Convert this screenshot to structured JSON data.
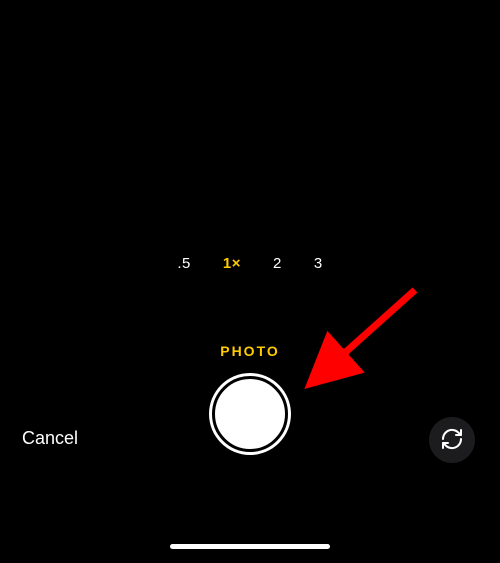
{
  "zoom": {
    "options": [
      ".5",
      "1×",
      "2",
      "3"
    ],
    "selected_index": 1
  },
  "mode": {
    "label": "PHOTO"
  },
  "controls": {
    "cancel_label": "Cancel"
  },
  "colors": {
    "accent": "#ffcc00",
    "background": "#000000",
    "text": "#ffffff",
    "flip_bg": "#1c1c1e",
    "annotation_arrow": "#ff0000"
  }
}
